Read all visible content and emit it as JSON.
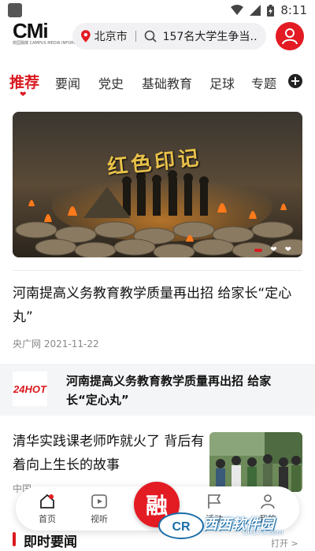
{
  "status_bar": {
    "time": "8:11",
    "icons": [
      "wifi-icon",
      "signal-icon",
      "battery-icon"
    ]
  },
  "header": {
    "logo_text": "CMi",
    "logo_subtitle": "校园融媒 CAMPUS MEDIA INFORMATION",
    "location": "北京市",
    "search_text": "157名大学生争当…",
    "avatar_icon": "user-icon"
  },
  "tabs": [
    {
      "label": "推荐",
      "active": true
    },
    {
      "label": "要闻",
      "active": false
    },
    {
      "label": "党史",
      "active": false
    },
    {
      "label": "基础教育",
      "active": false
    },
    {
      "label": "足球",
      "active": false
    },
    {
      "label": "专题",
      "active": false
    }
  ],
  "tab_add": "+",
  "banner": {
    "title": "红色印记",
    "slide_count": 3,
    "active_slide": 1
  },
  "articles": [
    {
      "title": "河南提高义务教育教学质量再出招 给家长“定心丸”",
      "source": "央广网",
      "date": "2021-11-22"
    },
    {
      "title": "清华实践课老师咋就火了 背后有着向上生长的故事",
      "source": "中国"
    }
  ],
  "promo": {
    "logo_text": "24HOT",
    "title": "河南提高义务教育教学质量再出招 给家长“定心丸”"
  },
  "section": {
    "title": "即时要闻"
  },
  "bottom_nav": {
    "items": [
      {
        "label": "首页",
        "icon": "home-icon"
      },
      {
        "label": "视听",
        "icon": "video-icon"
      },
      {
        "label": "活动",
        "icon": "flag-icon"
      },
      {
        "label": "我的",
        "icon": "profile-icon"
      }
    ],
    "center_label": "融"
  },
  "watermark": {
    "text": "西西软件园",
    "url": "CR173.com"
  },
  "open_label": "打开 >",
  "colors": {
    "accent": "#d9191f",
    "avatar_bg": "#e31b23",
    "search_bg": "#f1f1f3",
    "promo_bg": "#f4f5f7"
  }
}
